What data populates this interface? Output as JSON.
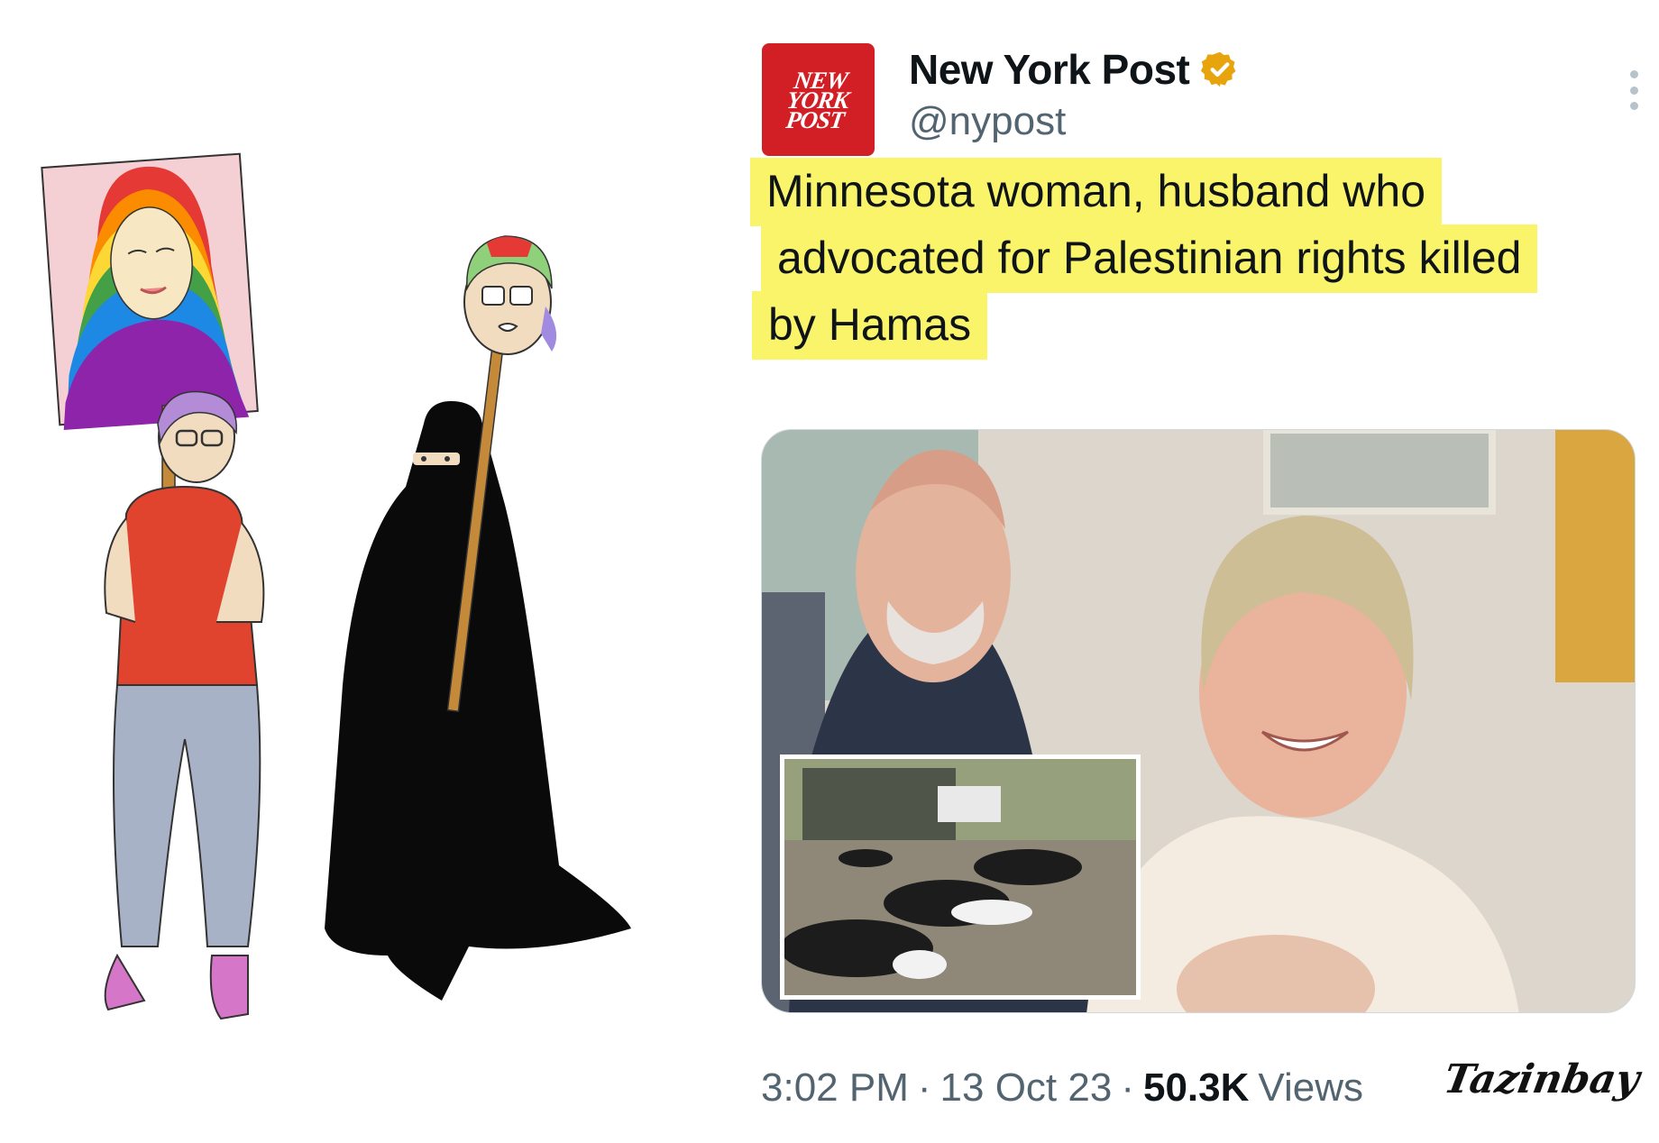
{
  "tweet": {
    "avatar_text": [
      "NEW",
      "YORK",
      "POST"
    ],
    "display_name": "New York Post",
    "handle": "@nypost",
    "headline_lines": [
      "Minnesota woman, husband who",
      "advocated for Palestinian rights killed",
      "by Hamas"
    ],
    "time": "3:02 PM",
    "date": "13 Oct 23",
    "views_count": "50.3K",
    "views_label": "Views",
    "separator": "·"
  },
  "icons": {
    "verified": "verified-badge-icon",
    "more": "more-options-icon"
  },
  "colors": {
    "brand_red": "#d21f25",
    "highlight": "#f9f46a",
    "verified_gold": "#e8a40c",
    "muted_text": "#536471"
  },
  "watermark": "Tazinbay"
}
